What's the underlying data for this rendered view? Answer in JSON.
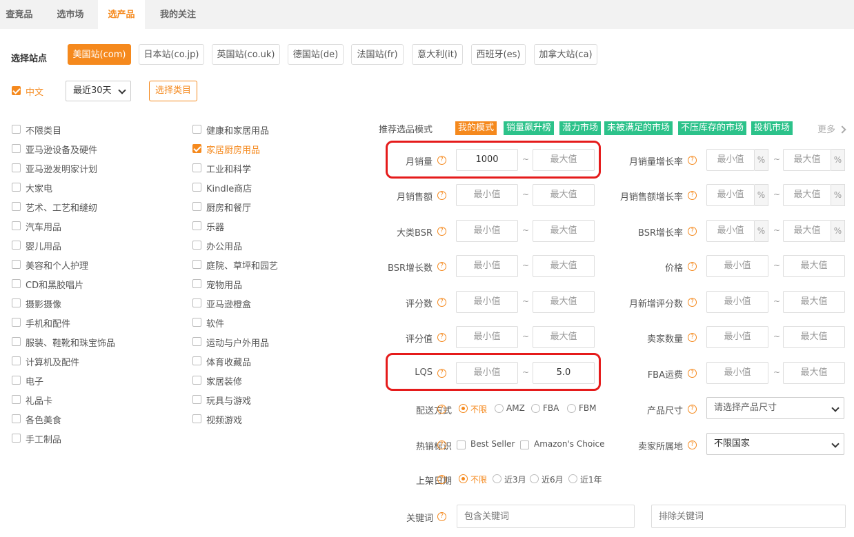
{
  "tabs": [
    "查竞品",
    "选市场",
    "选产品",
    "我的关注"
  ],
  "site": {
    "label": "选择站点",
    "options": [
      "美国站(com)",
      "日本站(co.jp)",
      "英国站(co.uk)",
      "德国站(de)",
      "法国站(fr)",
      "意大利(it)",
      "西班牙(es)",
      "加拿大站(ca)"
    ],
    "selected": "美国站(com)"
  },
  "options_row": {
    "chinese_label": "中文",
    "chinese_checked": true,
    "period": "最近30天",
    "choose_category": "选择类目"
  },
  "categories_left": [
    "不限类目",
    "亚马逊设备及硬件",
    "亚马逊发明家计划",
    "大家电",
    "艺术、工艺和缝纫",
    "汽车用品",
    "婴儿用品",
    "美容和个人护理",
    "CD和黑胶唱片",
    "摄影摄像",
    "手机和配件",
    "服装、鞋靴和珠宝饰品",
    "计算机及配件",
    "电子",
    "礼品卡",
    "各色美食",
    "手工制品"
  ],
  "categories_right": [
    "健康和家居用品",
    "家居厨房用品",
    "工业和科学",
    "Kindle商店",
    "厨房和餐厅",
    "乐器",
    "办公用品",
    "庭院、草坪和园艺",
    "宠物用品",
    "亚马逊橙盒",
    "软件",
    "运动与户外用品",
    "体育收藏品",
    "家居装修",
    "玩具与游戏",
    "视频游戏"
  ],
  "checked_category": "家居厨房用品",
  "mode": {
    "label": "推荐选品模式",
    "tags": [
      "我的模式",
      "销量飙升榜",
      "潜力市场",
      "未被满足的市场",
      "不压库存的市场",
      "投机市场"
    ],
    "tag_colors": [
      "#f5891d",
      "#2cc28a",
      "#2cc28a",
      "#2cc28a",
      "#2cc28a",
      "#2cc28a"
    ],
    "more": "更多"
  },
  "placeholders": {
    "min": "最小值",
    "max": "最大值"
  },
  "filters_left": [
    {
      "label": "月销量",
      "min": "1000",
      "max": ""
    },
    {
      "label": "月销售额",
      "min": "",
      "max": ""
    },
    {
      "label": "大类BSR",
      "min": "",
      "max": ""
    },
    {
      "label": "BSR增长数",
      "min": "",
      "max": ""
    },
    {
      "label": "评分数",
      "min": "",
      "max": ""
    },
    {
      "label": "评分值",
      "min": "",
      "max": ""
    },
    {
      "label": "LQS",
      "min": "",
      "max": "5.0"
    }
  ],
  "filters_right": [
    {
      "label": "月销量增长率",
      "unit": "%"
    },
    {
      "label": "月销售额增长率",
      "unit": "%"
    },
    {
      "label": "BSR增长率",
      "unit": "%"
    },
    {
      "label": "价格",
      "unit": ""
    },
    {
      "label": "月新增评分数",
      "unit": ""
    },
    {
      "label": "卖家数量",
      "unit": ""
    },
    {
      "label": "FBA运费",
      "unit": ""
    }
  ],
  "delivery": {
    "label": "配送方式",
    "options": [
      "不限",
      "AMZ",
      "FBA",
      "FBM"
    ],
    "selected": "不限"
  },
  "size": {
    "label": "产品尺寸",
    "placeholder": "请选择产品尺寸"
  },
  "hot": {
    "label": "热销标识",
    "options": [
      "Best Seller",
      "Amazon's Choice"
    ]
  },
  "seller_location": {
    "label": "卖家所属地",
    "value": "不限国家"
  },
  "listing_date": {
    "label": "上架日期",
    "options": [
      "不限",
      "近3月",
      "近6月",
      "近1年"
    ],
    "selected": "不限"
  },
  "keyword": {
    "label": "关键词",
    "include_placeholder": "包含关键词",
    "exclude_placeholder": "排除关键词"
  },
  "tilde": "~",
  "qmark": "?"
}
